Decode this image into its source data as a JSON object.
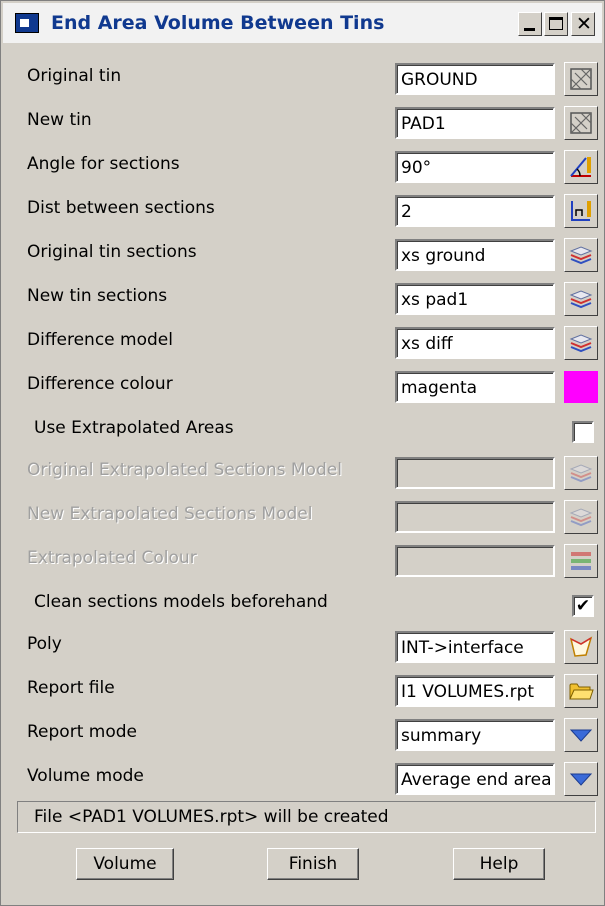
{
  "window": {
    "title": "End Area Volume Between Tins"
  },
  "rows": [
    {
      "label": "Original tin",
      "value": "GROUND",
      "icon": "tin-select-icon"
    },
    {
      "label": "New tin",
      "value": "PAD1",
      "icon": "tin-select-icon"
    },
    {
      "label": "Angle for sections",
      "value": "90°",
      "icon": "angle-pick-icon"
    },
    {
      "label": "Dist between sections",
      "value": "2",
      "icon": "distance-pick-icon"
    },
    {
      "label": "Original tin sections",
      "value": "xs ground",
      "icon": "model-layers-icon"
    },
    {
      "label": "New tin sections",
      "value": "xs pad1",
      "icon": "model-layers-icon"
    },
    {
      "label": "Difference model",
      "value": "xs diff",
      "icon": "model-layers-icon"
    },
    {
      "label": "Difference colour",
      "value": "magenta",
      "color": "#ff00ff"
    }
  ],
  "use_extrapolated": {
    "label": "Use Extrapolated Areas",
    "checked": false
  },
  "disabled_rows": [
    {
      "label": "Original Extrapolated Sections Model",
      "value": ""
    },
    {
      "label": "New Extrapolated Sections Model",
      "value": ""
    },
    {
      "label": "Extrapolated Colour",
      "value": ""
    }
  ],
  "clean_sections": {
    "label": "Clean sections models beforehand",
    "checked": true,
    "mark": "✔"
  },
  "rows2": [
    {
      "label": "Poly",
      "value": "INT->interface",
      "icon": "polygon-pick-icon"
    },
    {
      "label": "Report file",
      "value": "I1 VOLUMES.rpt",
      "icon": "folder-icon"
    },
    {
      "label": "Report mode",
      "value": "summary",
      "icon": "dropdown-arrow-icon"
    },
    {
      "label": "Volume mode",
      "value": "Average end area",
      "icon": "dropdown-arrow-icon"
    }
  ],
  "status": "File <PAD1 VOLUMES.rpt> will be created",
  "buttons": {
    "volume": "Volume",
    "finish": "Finish",
    "help": "Help"
  }
}
